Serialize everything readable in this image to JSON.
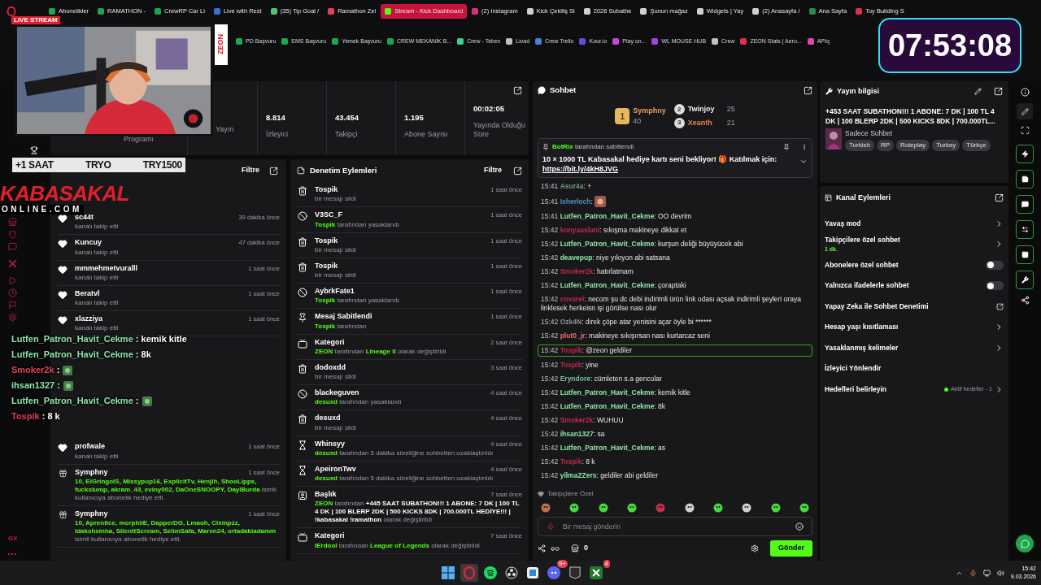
{
  "browser": {
    "tabs": [
      {
        "label": "Abonelikler",
        "selected": false,
        "color": "#1fa64a"
      },
      {
        "label": "RAMATHON -",
        "selected": false,
        "color": "#1fa64a"
      },
      {
        "label": "CrewRP Car Li",
        "selected": false,
        "color": "#1fa64a"
      },
      {
        "label": "Live with Rest",
        "selected": false,
        "color": "#3b6fd8"
      },
      {
        "label": "(35) Tip Goal /",
        "selected": false,
        "color": "#53c46a"
      },
      {
        "label": "Ramathon Zei",
        "selected": false,
        "color": "#e0405a"
      },
      {
        "label": "Stream - Kick Dashboard",
        "selected": true,
        "color": "#53fc18"
      },
      {
        "label": "(2) Instagram",
        "selected": false,
        "color": "#d6307a"
      },
      {
        "label": "Kick Çekiliş Si",
        "selected": false,
        "color": "#d0d0d0"
      },
      {
        "label": "2026 Subathe",
        "selected": false,
        "color": "#d0d0d0"
      },
      {
        "label": "Şunun mağaz",
        "selected": false,
        "color": "#d0d0d0"
      },
      {
        "label": "Widgets | Yay",
        "selected": false,
        "color": "#d0d0d0"
      },
      {
        "label": "(2) Anasayfa /",
        "selected": false,
        "color": "#d0d0d0"
      },
      {
        "label": "Ana Sayfa",
        "selected": false,
        "color": "#2b8a4a"
      },
      {
        "label": "Toy Building S",
        "selected": false,
        "color": "#e0304a"
      }
    ],
    "bookmarks": [
      {
        "label": "PD Başvuru",
        "color": "#1fa64a"
      },
      {
        "label": "EMS Başvuru",
        "color": "#1fa64a"
      },
      {
        "label": "Yemek Başvuru",
        "color": "#1fa64a"
      },
      {
        "label": "CREW MEKANİK B...",
        "color": "#1fa64a"
      },
      {
        "label": "Crew - Tebex",
        "color": "#3ecf8e"
      },
      {
        "label": "Livad",
        "color": "#c0c0c0"
      },
      {
        "label": "Crew Trello",
        "color": "#4a7fd8"
      },
      {
        "label": "Kour.io",
        "color": "#6a4ad8"
      },
      {
        "label": "Play on...",
        "color": "#c04ad8"
      },
      {
        "label": "WL MOUSE HUB",
        "color": "#9a4ad8"
      },
      {
        "label": "Crew",
        "color": "#c0c0c0"
      },
      {
        "label": "ZEON Stats | Aero...",
        "color": "#e0304a"
      },
      {
        "label": "APIq",
        "color": "#d84ab0"
      }
    ]
  },
  "overlays": {
    "live_label": "LIVE STREAM",
    "brand_tag": "ZEON",
    "timer": "07:53:08",
    "goal_bar": [
      "+1 SAAT",
      "TRYO",
      "TRY1500"
    ],
    "logo": {
      "title": "KABASAKAL",
      "subtitle": "ONLINE.COM"
    },
    "chat": [
      {
        "user": "Lutfen_Patron_Havit_Cekme",
        "text": ": kemik kitle",
        "color": "#8fe3a8",
        "emote": false
      },
      {
        "user": "Lutfen_Patron_Havit_Cekme",
        "text": ": 8k",
        "color": "#8fe3a8",
        "emote": false
      },
      {
        "user": "Smoker2k",
        "text": ":",
        "color": "#e0405a",
        "emote": true
      },
      {
        "user": "ihsan1327",
        "text": ":",
        "color": "#8fe3a8",
        "emote": true
      },
      {
        "user": "Lutfen_Patron_Havit_Cekme",
        "text": ":",
        "color": "#8fe3a8",
        "emote": true
      },
      {
        "user": "Tospik",
        "text": ": 8 k",
        "color": "#e0405a",
        "emote": false
      }
    ]
  },
  "sidebar": {
    "footer": "GX"
  },
  "stats": [
    {
      "label": "Programı"
    },
    {
      "label": "Yayın"
    },
    {
      "value": "8.814",
      "label": "İzleyici"
    },
    {
      "value": "43.454",
      "label": "Takipçi"
    },
    {
      "value": "1.195",
      "label": "Abone Sayısı"
    },
    {
      "value": "00:02:05",
      "label": "Yayında Olduğu Süre"
    }
  ],
  "activity": {
    "filter": "Filtre",
    "items": [
      {
        "kind": "follow",
        "title": "sc44t",
        "time": "39 dakika önce",
        "detail": [
          {
            "text": "kanalı takip etti",
            "accent": false,
            "strong": false
          }
        ]
      },
      {
        "kind": "follow",
        "title": "Kuncuy",
        "time": "47 dakika önce",
        "detail": [
          {
            "text": "kanalı takip etti",
            "accent": false,
            "strong": false
          }
        ]
      },
      {
        "kind": "follow",
        "title": "mmmehmetvuralll",
        "time": "1 saat önce",
        "detail": [
          {
            "text": "kanalı takip etti",
            "accent": false,
            "strong": false
          }
        ]
      },
      {
        "kind": "follow",
        "title": "Beratvl",
        "time": "1 saat önce",
        "detail": [
          {
            "text": "kanalı takip etti",
            "accent": false,
            "strong": false
          }
        ]
      },
      {
        "kind": "follow",
        "title": "xlazziya",
        "time": "1 saat önce",
        "detail": [
          {
            "text": "kanalı takip etti",
            "accent": false,
            "strong": false
          }
        ]
      }
    ],
    "items_below_overlay": [
      {
        "kind": "follow",
        "title": "profwale",
        "time": "1 saat önce",
        "detail": [
          {
            "text": "kanalı takip etti",
            "accent": false,
            "strong": false
          }
        ]
      },
      {
        "kind": "gift",
        "title": "Symphny",
        "time": "1 saat önce",
        "detail": [
          {
            "text": "10, ElGringolS, Missypup16, ExplicitTv, Henjih, ShooLipps, fuckslump, akram_43, eviny002, DaOneSNOOPY, DayiBurda",
            "accent": true,
            "strong": false
          },
          {
            "text": "isimli kullanıcıya abonelik hediye etti.",
            "accent": false,
            "strong": false
          }
        ]
      },
      {
        "kind": "gift",
        "title": "Symphny",
        "time": "1 saat önce",
        "detail": [
          {
            "text": "10, Aprentice, morphiiE, DapperDG, Lmaoh, Clxmpzz, idakshsinha, SilenttScream, SelimSafa, Maren24, ortadakiadamm",
            "accent": true,
            "strong": false
          },
          {
            "text": "isimli kullanıcıya abonelik hediye etti.",
            "accent": false,
            "strong": false
          }
        ]
      }
    ]
  },
  "moderation": {
    "title": "Denetim Eylemleri",
    "filter": "Filtre",
    "items": [
      {
        "kind": "delete",
        "title": "Tospik",
        "time": "1 saat önce",
        "detail": [
          {
            "text": "bir mesajı sildi",
            "accent": false,
            "strong": false
          }
        ]
      },
      {
        "kind": "ban",
        "title": "V3SC_F",
        "time": "1 saat önce",
        "detail": [
          {
            "text": "Tospik",
            "accent": true,
            "strong": false
          },
          {
            "text": "tarafından yasaklandı",
            "accent": false,
            "strong": false
          }
        ]
      },
      {
        "kind": "delete",
        "title": "Tospik",
        "time": "1 saat önce",
        "detail": [
          {
            "text": "bir mesajı sildi",
            "accent": false,
            "strong": false
          }
        ]
      },
      {
        "kind": "delete",
        "title": "Tospik",
        "time": "1 saat önce",
        "detail": [
          {
            "text": "bir mesajı sildi",
            "accent": false,
            "strong": false
          }
        ]
      },
      {
        "kind": "ban",
        "title": "AybrkFate1",
        "time": "1 saat önce",
        "detail": [
          {
            "text": "Tospik",
            "accent": true,
            "strong": false
          },
          {
            "text": "tarafından yasaklandı",
            "accent": false,
            "strong": false
          }
        ]
      },
      {
        "kind": "pin",
        "title": "Mesaj Sabitlendi",
        "time": "1 saat önce",
        "detail": [
          {
            "text": "Tospik",
            "accent": true,
            "strong": false
          },
          {
            "text": "tarafından",
            "accent": false,
            "strong": false
          }
        ]
      },
      {
        "kind": "category",
        "title": "Kategori",
        "time": "2 saat önce",
        "detail": [
          {
            "text": "ZEON",
            "accent": true,
            "strong": false
          },
          {
            "text": "tarafından",
            "accent": false,
            "strong": false
          },
          {
            "text": "Lineage II",
            "accent": true,
            "strong": false
          },
          {
            "text": "olarak değiştirildi",
            "accent": false,
            "strong": false
          }
        ]
      },
      {
        "kind": "delete",
        "title": "dodoxdd",
        "time": "3 saat önce",
        "detail": [
          {
            "text": "bir mesajı sildi",
            "accent": false,
            "strong": false
          }
        ]
      },
      {
        "kind": "ban",
        "title": "blackeguven",
        "time": "4 saat önce",
        "detail": [
          {
            "text": "desuxd",
            "accent": true,
            "strong": false
          },
          {
            "text": "tarafından yasaklandı",
            "accent": false,
            "strong": false
          }
        ]
      },
      {
        "kind": "delete",
        "title": "desuxd",
        "time": "4 saat önce",
        "detail": [
          {
            "text": "bir mesajı sildi",
            "accent": false,
            "strong": false
          }
        ]
      },
      {
        "kind": "timeout",
        "title": "Whinsyy",
        "time": "4 saat önce",
        "detail": [
          {
            "text": "desuxd",
            "accent": true,
            "strong": false
          },
          {
            "text": "tarafından 5 dakika süreliğine sohbetten uzaklaştırıldı",
            "accent": false,
            "strong": false
          }
        ]
      },
      {
        "kind": "timeout",
        "title": "ApeironTwv",
        "time": "4 saat önce",
        "detail": [
          {
            "text": "desuxd",
            "accent": true,
            "strong": false
          },
          {
            "text": "tarafından 5 dakika süreliğine sohbetten uzaklaştırıldı",
            "accent": false,
            "strong": false
          }
        ]
      },
      {
        "kind": "title",
        "title": "Başlık",
        "time": "7 saat önce",
        "detail": [
          {
            "text": "ZEON",
            "accent": true,
            "strong": false
          },
          {
            "text": "tarafından",
            "accent": false,
            "strong": false
          },
          {
            "text": "+445 SAAT SUBATHON!!! 1 ABONE: 7 DK | 100 TL 4 DK | 100 BLERP 2DK | 500 KICKS 8DK | 700.000TL HEDİYE!!! | !kabasakal !ramathon",
            "accent": false,
            "strong": true
          },
          {
            "text": "olarak değiştirildi",
            "accent": false,
            "strong": false
          }
        ]
      },
      {
        "kind": "category",
        "title": "Kategori",
        "time": "7 saat önce",
        "detail": [
          {
            "text": "IErdool",
            "accent": true,
            "strong": false
          },
          {
            "text": "tarafından",
            "accent": false,
            "strong": false
          },
          {
            "text": "League of Legends",
            "accent": true,
            "strong": false
          },
          {
            "text": "olarak değiştirildi",
            "accent": false,
            "strong": false
          }
        ]
      }
    ]
  },
  "chat": {
    "title": "Sohbet",
    "leaders": [
      {
        "rank": "1",
        "name": "Symphny",
        "count": "40",
        "color": "#e8a060"
      },
      {
        "rank": "2",
        "name": "Twinjoy",
        "count": "25",
        "color": "#f0f0f0"
      },
      {
        "rank": "3",
        "name": "Xeanth",
        "count": "21",
        "color": "#e88050"
      }
    ],
    "pinned": {
      "by": "BotRix",
      "by_text": "tarafından sabitlendi",
      "message": "10 × 1000 TL Kabasakal hediye kartı seni bekliyor! 🎁 Katılmak için:",
      "link": "https://bit.ly/4kH8JVG"
    },
    "messages": [
      {
        "time": "15:41",
        "user": "Asur4a",
        "color": "#6f9a86",
        "text": ": +",
        "emote": false,
        "highlighted": false
      },
      {
        "time": "15:41",
        "user": "Isherloch",
        "color": "#4f8fb8",
        "text": ":",
        "emote": true,
        "highlighted": false
      },
      {
        "time": "15:41",
        "user": "Lutfen_Patron_Havit_Cekme",
        "color": "#8fe3a8",
        "text": ": OO devrim",
        "emote": false,
        "highlighted": false
      },
      {
        "time": "15:42",
        "user": "konyaaslani",
        "color": "#c0284a",
        "text": ": sıkışma makineye dikkat et",
        "emote": false,
        "highlighted": false
      },
      {
        "time": "15:42",
        "user": "Lutfen_Patron_Havit_Cekme",
        "color": "#8fe3a8",
        "text": ": kurşun deliği büyüyücek abi",
        "emote": false,
        "highlighted": false
      },
      {
        "time": "15:42",
        "user": "deavepup",
        "color": "#8fe3a8",
        "text": ": niye yıkıyon abi satsana",
        "emote": false,
        "highlighted": false
      },
      {
        "time": "15:42",
        "user": "Smoker2k",
        "color": "#c0284a",
        "text": ": hatırlatmam",
        "emote": false,
        "highlighted": false
      },
      {
        "time": "15:42",
        "user": "Lutfen_Patron_Havit_Cekme",
        "color": "#8fe3a8",
        "text": ": çoraptaki",
        "emote": false,
        "highlighted": false
      },
      {
        "time": "15:42",
        "user": "covarei",
        "color": "#c0284a",
        "text": ": necom şu dc debi indirimli ürün link odası açsak indirimli şeyleri oraya linklesek herkeisn işi görülse nası olur",
        "emote": false,
        "highlighted": false
      },
      {
        "time": "15:42",
        "user": "Ozk4N",
        "color": "#8a9098",
        "text": ": direk çöpe atar yenisini açar öyle bi ******",
        "emote": false,
        "highlighted": false
      },
      {
        "time": "15:42",
        "user": "plut0_jr",
        "color": "#e07070",
        "text": ": makineye sıkışırsan nası kurtarcaz seni",
        "emote": false,
        "highlighted": false
      },
      {
        "time": "15:42",
        "user": "Tospik",
        "color": "#c0284a",
        "text": ": @zeon geldiler",
        "emote": false,
        "highlighted": true
      },
      {
        "time": "15:42",
        "user": "Tospik",
        "color": "#c0284a",
        "text": ": yine",
        "emote": false,
        "highlighted": false
      },
      {
        "time": "15:42",
        "user": "Eryndore",
        "color": "#7fb8a0",
        "text": ": cümleten s.a gencolar",
        "emote": false,
        "highlighted": false
      },
      {
        "time": "15:42",
        "user": "Lutfen_Patron_Havit_Cekme",
        "color": "#8fe3a8",
        "text": ": kemik kitle",
        "emote": false,
        "highlighted": false
      },
      {
        "time": "15:42",
        "user": "Lutfen_Patron_Havit_Cekme",
        "color": "#8fe3a8",
        "text": ": 8k",
        "emote": false,
        "highlighted": false
      },
      {
        "time": "15:42",
        "user": "Smoker2k",
        "color": "#c0284a",
        "text": ": WUHUU",
        "emote": false,
        "highlighted": false
      },
      {
        "time": "15:42",
        "user": "ihsan1327",
        "color": "#8fe3a8",
        "text": ": sa",
        "emote": false,
        "highlighted": false
      },
      {
        "time": "15:42",
        "user": "Lutfen_Patron_Havit_Cekme",
        "color": "#8fe3a8",
        "text": ": as",
        "emote": false,
        "highlighted": false
      },
      {
        "time": "15:42",
        "user": "Tospik",
        "color": "#c0284a",
        "text": ": 8 k",
        "emote": false,
        "highlighted": false
      },
      {
        "time": "15:42",
        "user": "yilmaZZers",
        "color": "#8fe3a8",
        "text": ": geldiler abi geldiler",
        "emote": false,
        "highlighted": false
      }
    ],
    "emote_section": "Takipçilere Özel",
    "input": {
      "placeholder": "Bir mesaj gönderin"
    },
    "kicks": "0",
    "send": "Gönder"
  },
  "stream_info": {
    "title": "Yayın bilgisi",
    "stream_title": "+453 SAAT SUBATHON!!! 1 ABONE: 7 DK | 100 TL 4 DK | 100 BLERP 2DK | 500 KICKS 8DK | 700.000TL...",
    "category": "Sadece Sohbet",
    "tags": [
      "Turkish",
      "RP",
      "Roleplay",
      "Turkey",
      "Türkçe"
    ]
  },
  "channel_actions": {
    "title": "Kanal Eylemleri",
    "items": [
      {
        "kind": "chevron",
        "label": "Yavaş mod"
      },
      {
        "kind": "chevron",
        "label": "Takipçilere özel sohbet",
        "sub": "1 dk."
      },
      {
        "kind": "toggle",
        "label": "Abonelere özel sohbet",
        "on": false
      },
      {
        "kind": "toggle",
        "label": "Yalnızca ifadelerle sohbet",
        "on": false
      },
      {
        "kind": "external",
        "label": "Yapay Zeka ile Sohbet Denetimi"
      },
      {
        "kind": "chevron",
        "label": "Hesap yaşı kısıtlaması"
      },
      {
        "kind": "chevron",
        "label": "Yasaklanmış kelimeler"
      },
      {
        "kind": "plain",
        "label": "İzleyici Yönlendir"
      },
      {
        "kind": "chevron",
        "label": "Hedefleri belirleyin",
        "status": "Aktif hedefler - 1"
      }
    ]
  },
  "taskbar": {
    "apps": [
      {
        "kind": "start"
      },
      {
        "kind": "opera",
        "selected": true
      },
      {
        "kind": "spotify",
        "selected": false
      },
      {
        "kind": "obs",
        "selected": false
      },
      {
        "kind": "window",
        "selected": false
      },
      {
        "kind": "discord",
        "selected": false,
        "badge": "9+"
      },
      {
        "kind": "epic",
        "selected": false
      },
      {
        "kind": "xbox",
        "selected": false,
        "badge": "4"
      }
    ],
    "time": "15:42",
    "date": "9.03.2026"
  }
}
